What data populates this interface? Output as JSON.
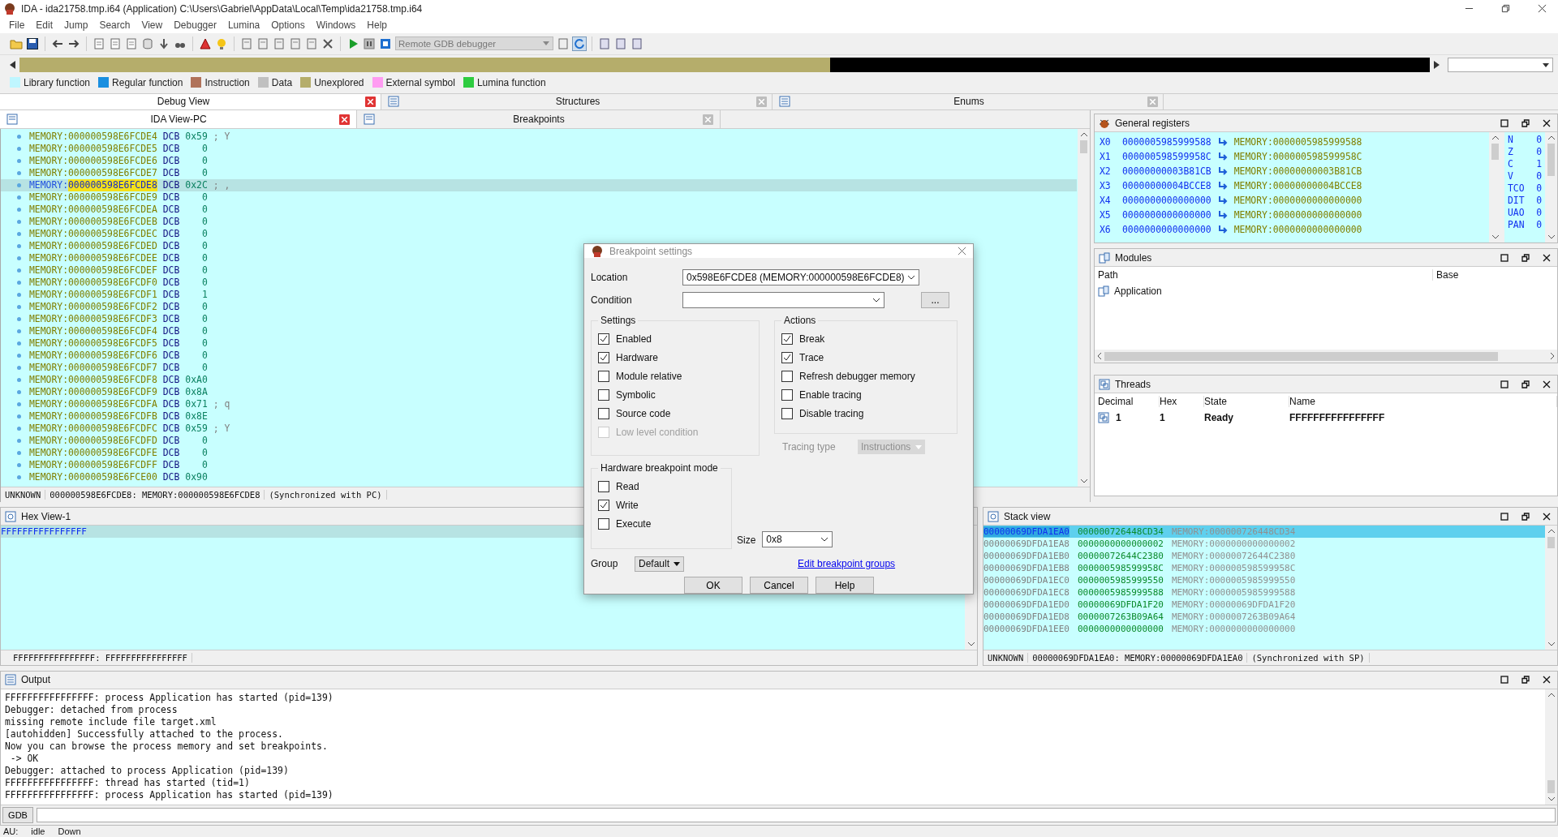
{
  "window": {
    "title": "IDA - ida21758.tmp.i64 (Application) C:\\Users\\Gabriel\\AppData\\Local\\Temp\\ida21758.tmp.i64"
  },
  "menu": [
    "File",
    "Edit",
    "Jump",
    "Search",
    "View",
    "Debugger",
    "Lumina",
    "Options",
    "Windows",
    "Help"
  ],
  "toolbar": {
    "debugger": "Remote GDB debugger"
  },
  "legend": [
    {
      "label": "Library function",
      "color": "#bff6ff"
    },
    {
      "label": "Regular function",
      "color": "#1a8fe0"
    },
    {
      "label": "Instruction",
      "color": "#b0725a"
    },
    {
      "label": "Data",
      "color": "#c0c0c0"
    },
    {
      "label": "Unexplored",
      "color": "#b5ad6b"
    },
    {
      "label": "External symbol",
      "color": "#ff9cf2"
    },
    {
      "label": "Lumina function",
      "color": "#2ecc40"
    }
  ],
  "tabs_top": [
    {
      "label": "Debug View",
      "selected": true
    },
    {
      "label": "Structures",
      "selected": false
    },
    {
      "label": "Enums",
      "selected": false
    }
  ],
  "tabs_view": [
    {
      "label": "IDA View-PC",
      "selected": true
    },
    {
      "label": "Breakpoints",
      "selected": false
    }
  ],
  "disassembly": {
    "lines": [
      {
        "segment": "MEMORY:",
        "address": "000000598E6FCDE4",
        "mnemonic": "DCB",
        "operand": "0x59",
        "comment": "; Y",
        "selected": false
      },
      {
        "segment": "MEMORY:",
        "address": "000000598E6FCDE5",
        "mnemonic": "DCB",
        "operand": "0",
        "selected": false
      },
      {
        "segment": "MEMORY:",
        "address": "000000598E6FCDE6",
        "mnemonic": "DCB",
        "operand": "0",
        "selected": false
      },
      {
        "segment": "MEMORY:",
        "address": "000000598E6FCDE7",
        "mnemonic": "DCB",
        "operand": "0",
        "selected": false
      },
      {
        "segment": "MEMORY:",
        "address": "000000598E6FCDE8",
        "mnemonic": "DCB",
        "operand": "0x2C",
        "comment": "; ,",
        "selected": true
      },
      {
        "segment": "MEMORY:",
        "address": "000000598E6FCDE9",
        "mnemonic": "DCB",
        "operand": "0",
        "selected": false
      },
      {
        "segment": "MEMORY:",
        "address": "000000598E6FCDEA",
        "mnemonic": "DCB",
        "operand": "0",
        "selected": false
      },
      {
        "segment": "MEMORY:",
        "address": "000000598E6FCDEB",
        "mnemonic": "DCB",
        "operand": "0",
        "selected": false
      },
      {
        "segment": "MEMORY:",
        "address": "000000598E6FCDEC",
        "mnemonic": "DCB",
        "operand": "0",
        "selected": false
      },
      {
        "segment": "MEMORY:",
        "address": "000000598E6FCDED",
        "mnemonic": "DCB",
        "operand": "0",
        "selected": false
      },
      {
        "segment": "MEMORY:",
        "address": "000000598E6FCDEE",
        "mnemonic": "DCB",
        "operand": "0",
        "selected": false
      },
      {
        "segment": "MEMORY:",
        "address": "000000598E6FCDEF",
        "mnemonic": "DCB",
        "operand": "0",
        "selected": false
      },
      {
        "segment": "MEMORY:",
        "address": "000000598E6FCDF0",
        "mnemonic": "DCB",
        "operand": "0",
        "selected": false
      },
      {
        "segment": "MEMORY:",
        "address": "000000598E6FCDF1",
        "mnemonic": "DCB",
        "operand": "1",
        "selected": false
      },
      {
        "segment": "MEMORY:",
        "address": "000000598E6FCDF2",
        "mnemonic": "DCB",
        "operand": "0",
        "selected": false
      },
      {
        "segment": "MEMORY:",
        "address": "000000598E6FCDF3",
        "mnemonic": "DCB",
        "operand": "0",
        "selected": false
      },
      {
        "segment": "MEMORY:",
        "address": "000000598E6FCDF4",
        "mnemonic": "DCB",
        "operand": "0",
        "selected": false
      },
      {
        "segment": "MEMORY:",
        "address": "000000598E6FCDF5",
        "mnemonic": "DCB",
        "operand": "0",
        "selected": false
      },
      {
        "segment": "MEMORY:",
        "address": "000000598E6FCDF6",
        "mnemonic": "DCB",
        "operand": "0",
        "selected": false
      },
      {
        "segment": "MEMORY:",
        "address": "000000598E6FCDF7",
        "mnemonic": "DCB",
        "operand": "0",
        "selected": false
      },
      {
        "segment": "MEMORY:",
        "address": "000000598E6FCDF8",
        "mnemonic": "DCB",
        "operand": "0xA0",
        "selected": false
      },
      {
        "segment": "MEMORY:",
        "address": "000000598E6FCDF9",
        "mnemonic": "DCB",
        "operand": "0x8A",
        "selected": false
      },
      {
        "segment": "MEMORY:",
        "address": "000000598E6FCDFA",
        "mnemonic": "DCB",
        "operand": "0x71",
        "comment": "; q",
        "selected": false
      },
      {
        "segment": "MEMORY:",
        "address": "000000598E6FCDFB",
        "mnemonic": "DCB",
        "operand": "0x8E",
        "selected": false
      },
      {
        "segment": "MEMORY:",
        "address": "000000598E6FCDFC",
        "mnemonic": "DCB",
        "operand": "0x59",
        "comment": "; Y",
        "selected": false
      },
      {
        "segment": "MEMORY:",
        "address": "000000598E6FCDFD",
        "mnemonic": "DCB",
        "operand": "0",
        "selected": false
      },
      {
        "segment": "MEMORY:",
        "address": "000000598E6FCDFE",
        "mnemonic": "DCB",
        "operand": "0",
        "selected": false
      },
      {
        "segment": "MEMORY:",
        "address": "000000598E6FCDFF",
        "mnemonic": "DCB",
        "operand": "0",
        "selected": false
      },
      {
        "segment": "MEMORY:",
        "address": "000000598E6FCE00",
        "mnemonic": "DCB",
        "operand": "0x90",
        "selected": false
      }
    ],
    "status": [
      "UNKNOWN",
      "000000598E6FCDE8: MEMORY:000000598E6FCDE8",
      "(Synchronized with PC)"
    ]
  },
  "registers": {
    "title": "General registers",
    "rows": [
      {
        "name": "X0",
        "value": "0000005985999588",
        "ref": "MEMORY:0000005985999588"
      },
      {
        "name": "X1",
        "value": "000000598599958C",
        "ref": "MEMORY:000000598599958C"
      },
      {
        "name": "X2",
        "value": "00000000003B81CB",
        "ref": "MEMORY:00000000003B81CB"
      },
      {
        "name": "X3",
        "value": "00000000004BCCE8",
        "ref": "MEMORY:00000000004BCCE8"
      },
      {
        "name": "X4",
        "value": "0000000000000000",
        "ref": "MEMORY:0000000000000000"
      },
      {
        "name": "X5",
        "value": "0000000000000000",
        "ref": "MEMORY:0000000000000000"
      },
      {
        "name": "X6",
        "value": "0000000000000000",
        "ref": "MEMORY:0000000000000000"
      }
    ],
    "flags": [
      {
        "name": "N",
        "value": "0"
      },
      {
        "name": "Z",
        "value": "0"
      },
      {
        "name": "C",
        "value": "1"
      },
      {
        "name": "V",
        "value": "0"
      },
      {
        "name": "TCO",
        "value": "0"
      },
      {
        "name": "DIT",
        "value": "0"
      },
      {
        "name": "UAO",
        "value": "0"
      },
      {
        "name": "PAN",
        "value": "0"
      }
    ]
  },
  "modules": {
    "title": "Modules",
    "columns": [
      "Path",
      "Base"
    ],
    "rows": [
      {
        "path": "Application"
      }
    ]
  },
  "threads": {
    "title": "Threads",
    "columns": [
      "Decimal",
      "Hex",
      "State",
      "Name"
    ],
    "rows": [
      {
        "decimal": "1",
        "hex": "1",
        "state": "Ready",
        "name": "FFFFFFFFFFFFFFFF"
      }
    ]
  },
  "hex_view": {
    "title": "Hex View-1",
    "rows": [
      {
        "text": "FFFFFFFFFFFFFFFF",
        "selected": true
      }
    ],
    "status": "FFFFFFFFFFFFFFFF: FFFFFFFFFFFFFFFF"
  },
  "stack_view": {
    "title": "Stack view",
    "rows": [
      {
        "address": "00000069DFDA1EA0",
        "value": "000000726448CD34",
        "ref": "MEMORY:000000726448CD34",
        "selected": true
      },
      {
        "address": "00000069DFDA1EA8",
        "value": "0000000000000002",
        "ref": "MEMORY:0000000000000002",
        "selected": false
      },
      {
        "address": "00000069DFDA1EB0",
        "value": "00000072644C2380",
        "ref": "MEMORY:00000072644C2380",
        "selected": false
      },
      {
        "address": "00000069DFDA1EB8",
        "value": "000000598599958C",
        "ref": "MEMORY:000000598599958C",
        "selected": false
      },
      {
        "address": "00000069DFDA1EC0",
        "value": "0000005985999550",
        "ref": "MEMORY:0000005985999550",
        "selected": false
      },
      {
        "address": "00000069DFDA1EC8",
        "value": "0000005985999588",
        "ref": "MEMORY:0000005985999588",
        "selected": false
      },
      {
        "address": "00000069DFDA1ED0",
        "value": "00000069DFDA1F20",
        "ref": "MEMORY:00000069DFDA1F20",
        "selected": false
      },
      {
        "address": "00000069DFDA1ED8",
        "value": "0000007263B09A64",
        "ref": "MEMORY:0000007263B09A64",
        "selected": false
      },
      {
        "address": "00000069DFDA1EE0",
        "value": "0000000000000000",
        "ref": "MEMORY:0000000000000000",
        "selected": false
      }
    ],
    "status": [
      "UNKNOWN",
      "00000069DFDA1EA0: MEMORY:00000069DFDA1EA0",
      "(Synchronized with SP)"
    ]
  },
  "output": {
    "title": "Output",
    "lines": [
      "FFFFFFFFFFFFFFFF: process Application has started (pid=139)",
      "Debugger: detached from process",
      "missing remote include file target.xml",
      "[autohidden] Successfully attached to the process.",
      "Now you can browse the process memory and set breakpoints.",
      " -> OK",
      "Debugger: attached to process Application (pid=139)",
      "FFFFFFFFFFFFFFFF: thread has started (tid=1)",
      "FFFFFFFFFFFFFFFF: process Application has started (pid=139)"
    ],
    "command_button": "GDB"
  },
  "status_bar": [
    "AU:",
    "idle",
    "Down"
  ],
  "dialog": {
    "title": "Breakpoint settings",
    "location_label": "Location",
    "location": "0x598E6FCDE8 (MEMORY:000000598E6FCDE8)",
    "condition_label": "Condition",
    "more_button": "...",
    "settings": {
      "title": "Settings",
      "items": [
        {
          "label": "Enabled",
          "checked": true,
          "disabled": false
        },
        {
          "label": "Hardware",
          "checked": true,
          "disabled": false
        },
        {
          "label": "Module relative",
          "checked": false,
          "disabled": false
        },
        {
          "label": "Symbolic",
          "checked": false,
          "disabled": false
        },
        {
          "label": "Source code",
          "checked": false,
          "disabled": false
        },
        {
          "label": "Low level condition",
          "checked": false,
          "disabled": true
        }
      ]
    },
    "actions": {
      "title": "Actions",
      "items": [
        {
          "label": "Break",
          "checked": true,
          "disabled": false
        },
        {
          "label": "Trace",
          "checked": true,
          "disabled": false
        },
        {
          "label": "Refresh debugger memory",
          "checked": false,
          "disabled": false
        },
        {
          "label": "Enable tracing",
          "checked": false,
          "disabled": false
        },
        {
          "label": "Disable tracing",
          "checked": false,
          "disabled": false
        }
      ]
    },
    "tracing_type": {
      "label": "Tracing type",
      "value": "Instructions",
      "disabled": true
    },
    "hw_mode": {
      "title": "Hardware breakpoint mode",
      "items": [
        {
          "label": "Read",
          "checked": false,
          "disabled": false
        },
        {
          "label": "Write",
          "checked": true,
          "disabled": false
        },
        {
          "label": "Execute",
          "checked": false,
          "disabled": false
        }
      ]
    },
    "size": {
      "label": "Size",
      "value": "0x8"
    },
    "group": {
      "label": "Group",
      "value": "Default"
    },
    "link": "Edit breakpoint groups",
    "buttons": [
      "OK",
      "Cancel",
      "Help"
    ]
  }
}
